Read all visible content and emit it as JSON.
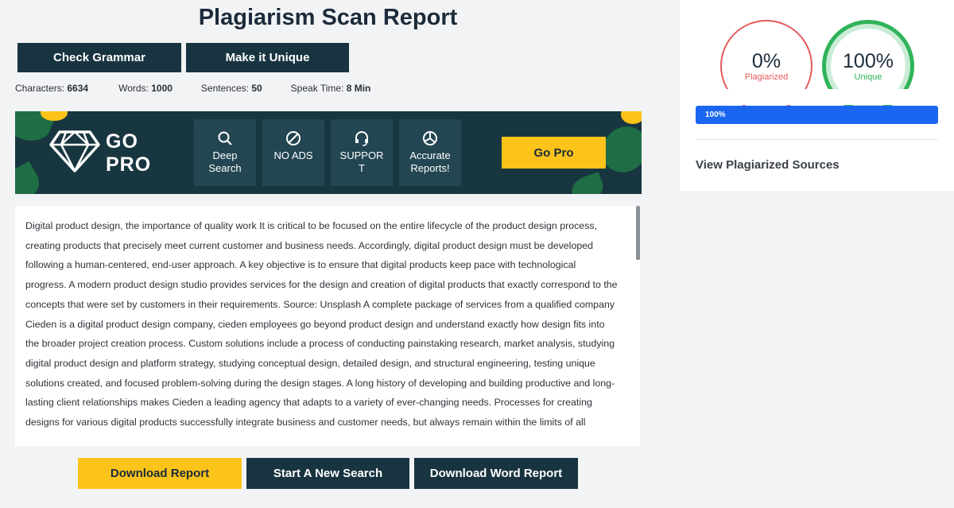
{
  "page": {
    "title": "Plagiarism Scan Report"
  },
  "actions": {
    "check_grammar": "Check Grammar",
    "make_unique": "Make it Unique"
  },
  "stats": [
    {
      "label": "Characters:",
      "value": "6634"
    },
    {
      "label": "Words:",
      "value": "1000"
    },
    {
      "label": "Sentences:",
      "value": "50"
    },
    {
      "label": "Speak Time:",
      "value": "8 Min"
    }
  ],
  "banner": {
    "go": "GO",
    "pro": "PRO",
    "features": [
      {
        "icon": "search-icon",
        "line1": "Deep",
        "line2": "Search"
      },
      {
        "icon": "no-ads-icon",
        "line1": "NO ADS",
        "line2": ""
      },
      {
        "icon": "headset-icon",
        "line1": "SUPPOR",
        "line2": "T"
      },
      {
        "icon": "pie-chart-icon",
        "line1": "Accurate",
        "line2": "Reports!"
      }
    ],
    "button": "Go Pro",
    "colors": {
      "bg": "#18363f",
      "tile": "#234652",
      "accent": "#fcc31a",
      "leaf": "#1f6d45"
    }
  },
  "content": {
    "text": "Digital product design, the importance of quality work It is critical to be focused on the entire lifecycle of the product design process, creating products that precisely meet current customer and business needs. Accordingly, digital product design must be developed following a human-centered, end-user approach. A key objective is to ensure that digital products keep pace with technological progress. A modern product design studio provides services for the design and creation of digital products that exactly correspond to the concepts that were set by customers in their requirements. Source: Unsplash A complete package of services from a qualified company Cieden is a digital product design company, cieden employees go beyond product design and understand exactly how design fits into the broader project creation process. Custom solutions include a process of conducting painstaking research, market analysis, studying digital product design and platform strategy, studying conceptual design, detailed design, and structural engineering, testing unique solutions created, and focused problem-solving during the design stages. A long history of developing and building productive and long-lasting client relationships makes Cieden a leading agency that adapts to a variety of ever-changing needs. Processes for creating designs for various digital products successfully integrate business and customer needs, but always remain within the limits of all"
  },
  "footer": {
    "download_report": "Download Report",
    "new_search": "Start A New Search",
    "download_word": "Download Word Report"
  },
  "results": {
    "plagiarized": {
      "value": "0%",
      "label": "Plagiarized",
      "color": "#e55a5a"
    },
    "unique": {
      "value": "100%",
      "label": "Unique",
      "color": "#2fb35a"
    },
    "progress": {
      "value": 100,
      "label": "100%",
      "color": "#1a66f0"
    },
    "sources_link": "View Plagiarized Sources"
  }
}
